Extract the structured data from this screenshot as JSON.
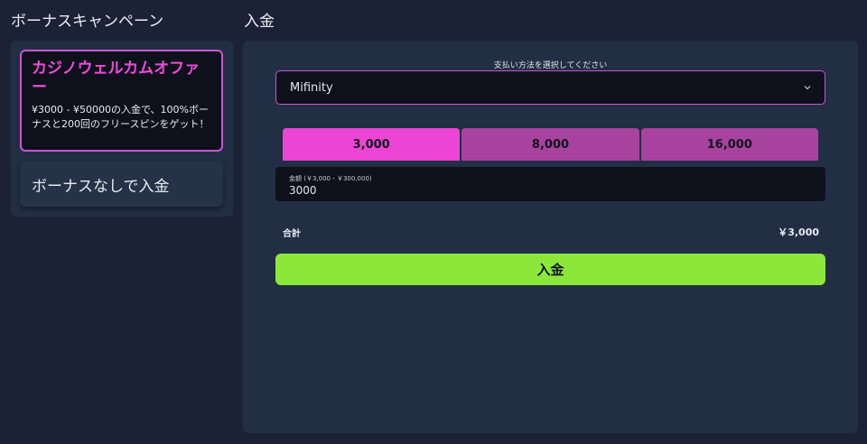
{
  "bonus": {
    "heading": "ボーナスキャンペーン",
    "offer": {
      "title": "カジノウェルカムオファー",
      "description": "¥3000 - ¥50000の入金で、100%ボーナスと200回のフリースピンをゲット！"
    },
    "no_bonus_label": "ボーナスなしで入金"
  },
  "deposit": {
    "heading": "入金",
    "method_label": "支払い方法を選択してください",
    "method_value": "Mifinity",
    "amount_presets": [
      "3,000",
      "8,000",
      "16,000"
    ],
    "amount_label": "金額 (￥3,000 - ￥300,000)",
    "amount_value": "3000",
    "total_label": "合計",
    "total_value": "￥3,000",
    "submit_label": "入金"
  },
  "colors": {
    "accent_pink": "#ec45d5",
    "tab_pink": "#a8429f",
    "submit_green": "#8be83b",
    "panel": "#222e43",
    "background": "#1b2236"
  },
  "icons": {
    "select_indicator": "chevron-down-icon"
  }
}
